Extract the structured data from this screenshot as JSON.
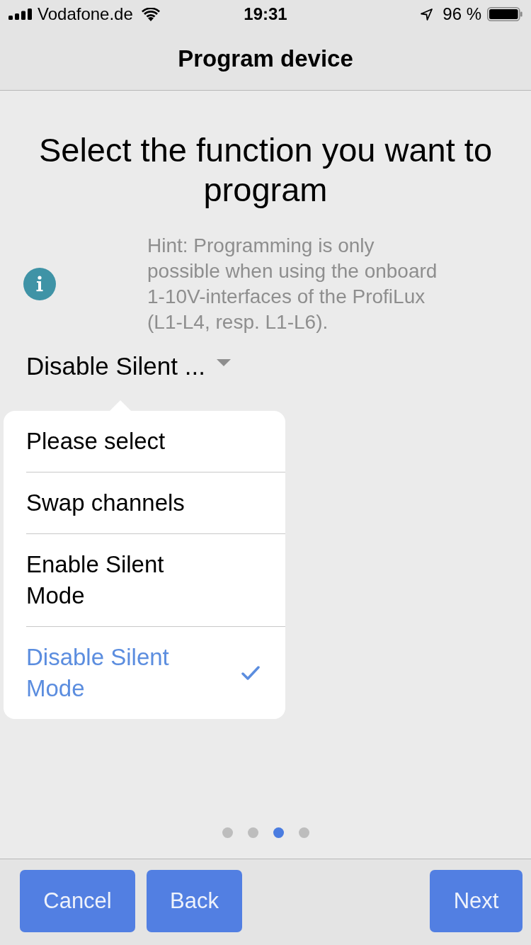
{
  "status_bar": {
    "carrier": "Vodafone.de",
    "time": "19:31",
    "battery": "96 %"
  },
  "nav_bar": {
    "title": "Program device"
  },
  "heading": "Select the function you want to program",
  "hint": "Hint: Programming is only possible when using the onboard 1-10V-interfaces of the ProfiLux (L1-L4, resp. L1-L6).",
  "dropdown": {
    "value": "Disable Silent ...",
    "expanded": true
  },
  "menu": [
    {
      "label": "Please select",
      "selected": false
    },
    {
      "label": "Swap channels",
      "selected": false
    },
    {
      "label": "Enable Silent Mode",
      "selected": false
    },
    {
      "label": "Disable Silent Mode",
      "selected": true
    }
  ],
  "pager": [
    {
      "selected": false
    },
    {
      "selected": false
    },
    {
      "selected": true
    },
    {
      "selected": false
    }
  ],
  "buttons": [
    {
      "label": "Cancel"
    },
    {
      "label": "Back"
    },
    {
      "label": "Next"
    }
  ]
}
